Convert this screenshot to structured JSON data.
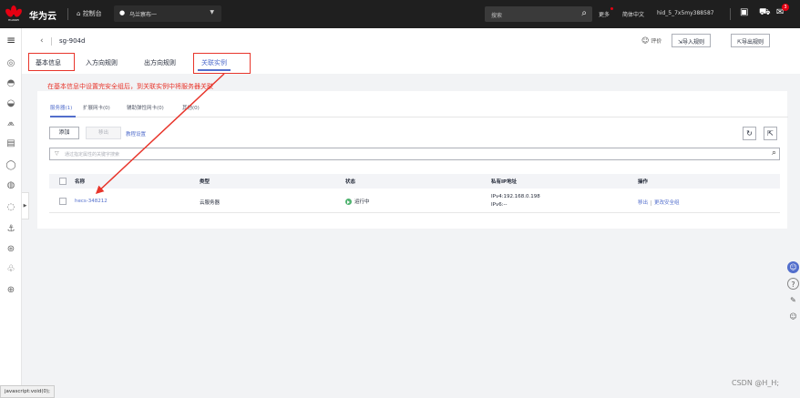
{
  "topbar": {
    "logo_text": "HUAWEI",
    "brand": "华为云",
    "console_label": "控制台",
    "region": "乌兰察布一",
    "search_placeholder": "搜索",
    "more": "更多",
    "language": "简体中文",
    "username": "hid_5_7x5my388587",
    "notification_count": "3"
  },
  "page_header": {
    "security_group_name": "sg-904d",
    "rate_label": "评价",
    "import_button": "导入规则",
    "export_button": "导出规则"
  },
  "tabs": [
    "基本信息",
    "入方向规则",
    "出方向规则",
    "关联实例"
  ],
  "annotation": "在基本信息中设置完安全组后，到关联实例中将服务器关联",
  "subtabs": [
    "服务器(1)",
    "扩展网卡(0)",
    "辅助弹性网卡(0)",
    "其他(0)"
  ],
  "toolbar": {
    "add_button": "添加",
    "remove_button": "移出",
    "tutorial_link": "教程设置",
    "refresh_icon": "↻",
    "export_icon": "⇱"
  },
  "filter": {
    "placeholder": "通过指定属性的关键字搜索"
  },
  "table": {
    "headers": [
      "名称",
      "类型",
      "状态",
      "私有IP地址",
      "操作"
    ],
    "rows": [
      {
        "name": "hecs-348212",
        "type": "云服务器",
        "status": "运行中",
        "ipv4": "IPv4:192.168.0.198",
        "ipv6": "IPv6:--",
        "op_remove": "移出",
        "op_change": "更改安全组"
      }
    ]
  },
  "footer": {
    "watermark": "CSDN @H_H;",
    "status_bar": "javascript:void(0);"
  },
  "colors": {
    "accent": "#526ecc",
    "annotation_red": "#e8352b",
    "running_green": "#50b370",
    "topbar_bg": "#1f1f1f"
  }
}
